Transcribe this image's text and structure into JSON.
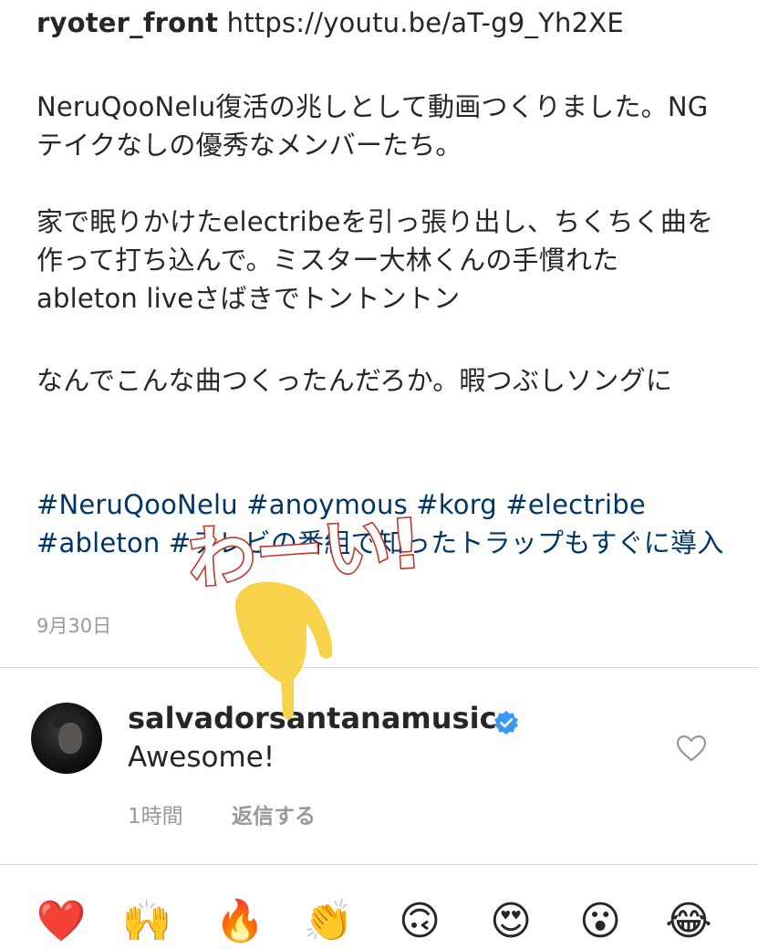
{
  "post": {
    "username": "ryoter_front",
    "link": "https://youtu.be/aT-g9_Yh2XE",
    "para1": "NeruQooNelu復活の兆しとして動画つくりました。NGテイクなしの優秀なメンバーたち。",
    "para2": "家で眠りかけたelectribeを引っ張り出し、ちくちく曲を作って打ち込んで。ミスター大林くんの手慣れたableton liveさばきでトントントン",
    "para3": "なんでこんな曲つくったんだろか。暇つぶしソングに",
    "para4": "#NeruQooNelu #anoymous #korg #electribe #ableton #テレビの番組で知ったトラップもすぐに導入",
    "date": "9月30日"
  },
  "annotation": {
    "text": "わーい!",
    "color": "#c0392b",
    "pointer_color": "#f7d24a",
    "pointer_icon": "pointing-down-hand-icon"
  },
  "comment": {
    "username": "salvadorsantanamusic",
    "verified_icon": "verified-badge-icon",
    "text": "Awesome!",
    "time": "1時間",
    "reply_label": "返信する",
    "like_icon": "heart-outline-icon"
  },
  "emoji_bar": {
    "items": [
      "❤️",
      "🙌",
      "🔥",
      "👏",
      "🙃",
      "😍",
      "😮",
      "😂"
    ]
  },
  "colors": {
    "hashtag": "#003569",
    "verified": "#3897f0",
    "muted": "#999999",
    "text": "#262626"
  }
}
